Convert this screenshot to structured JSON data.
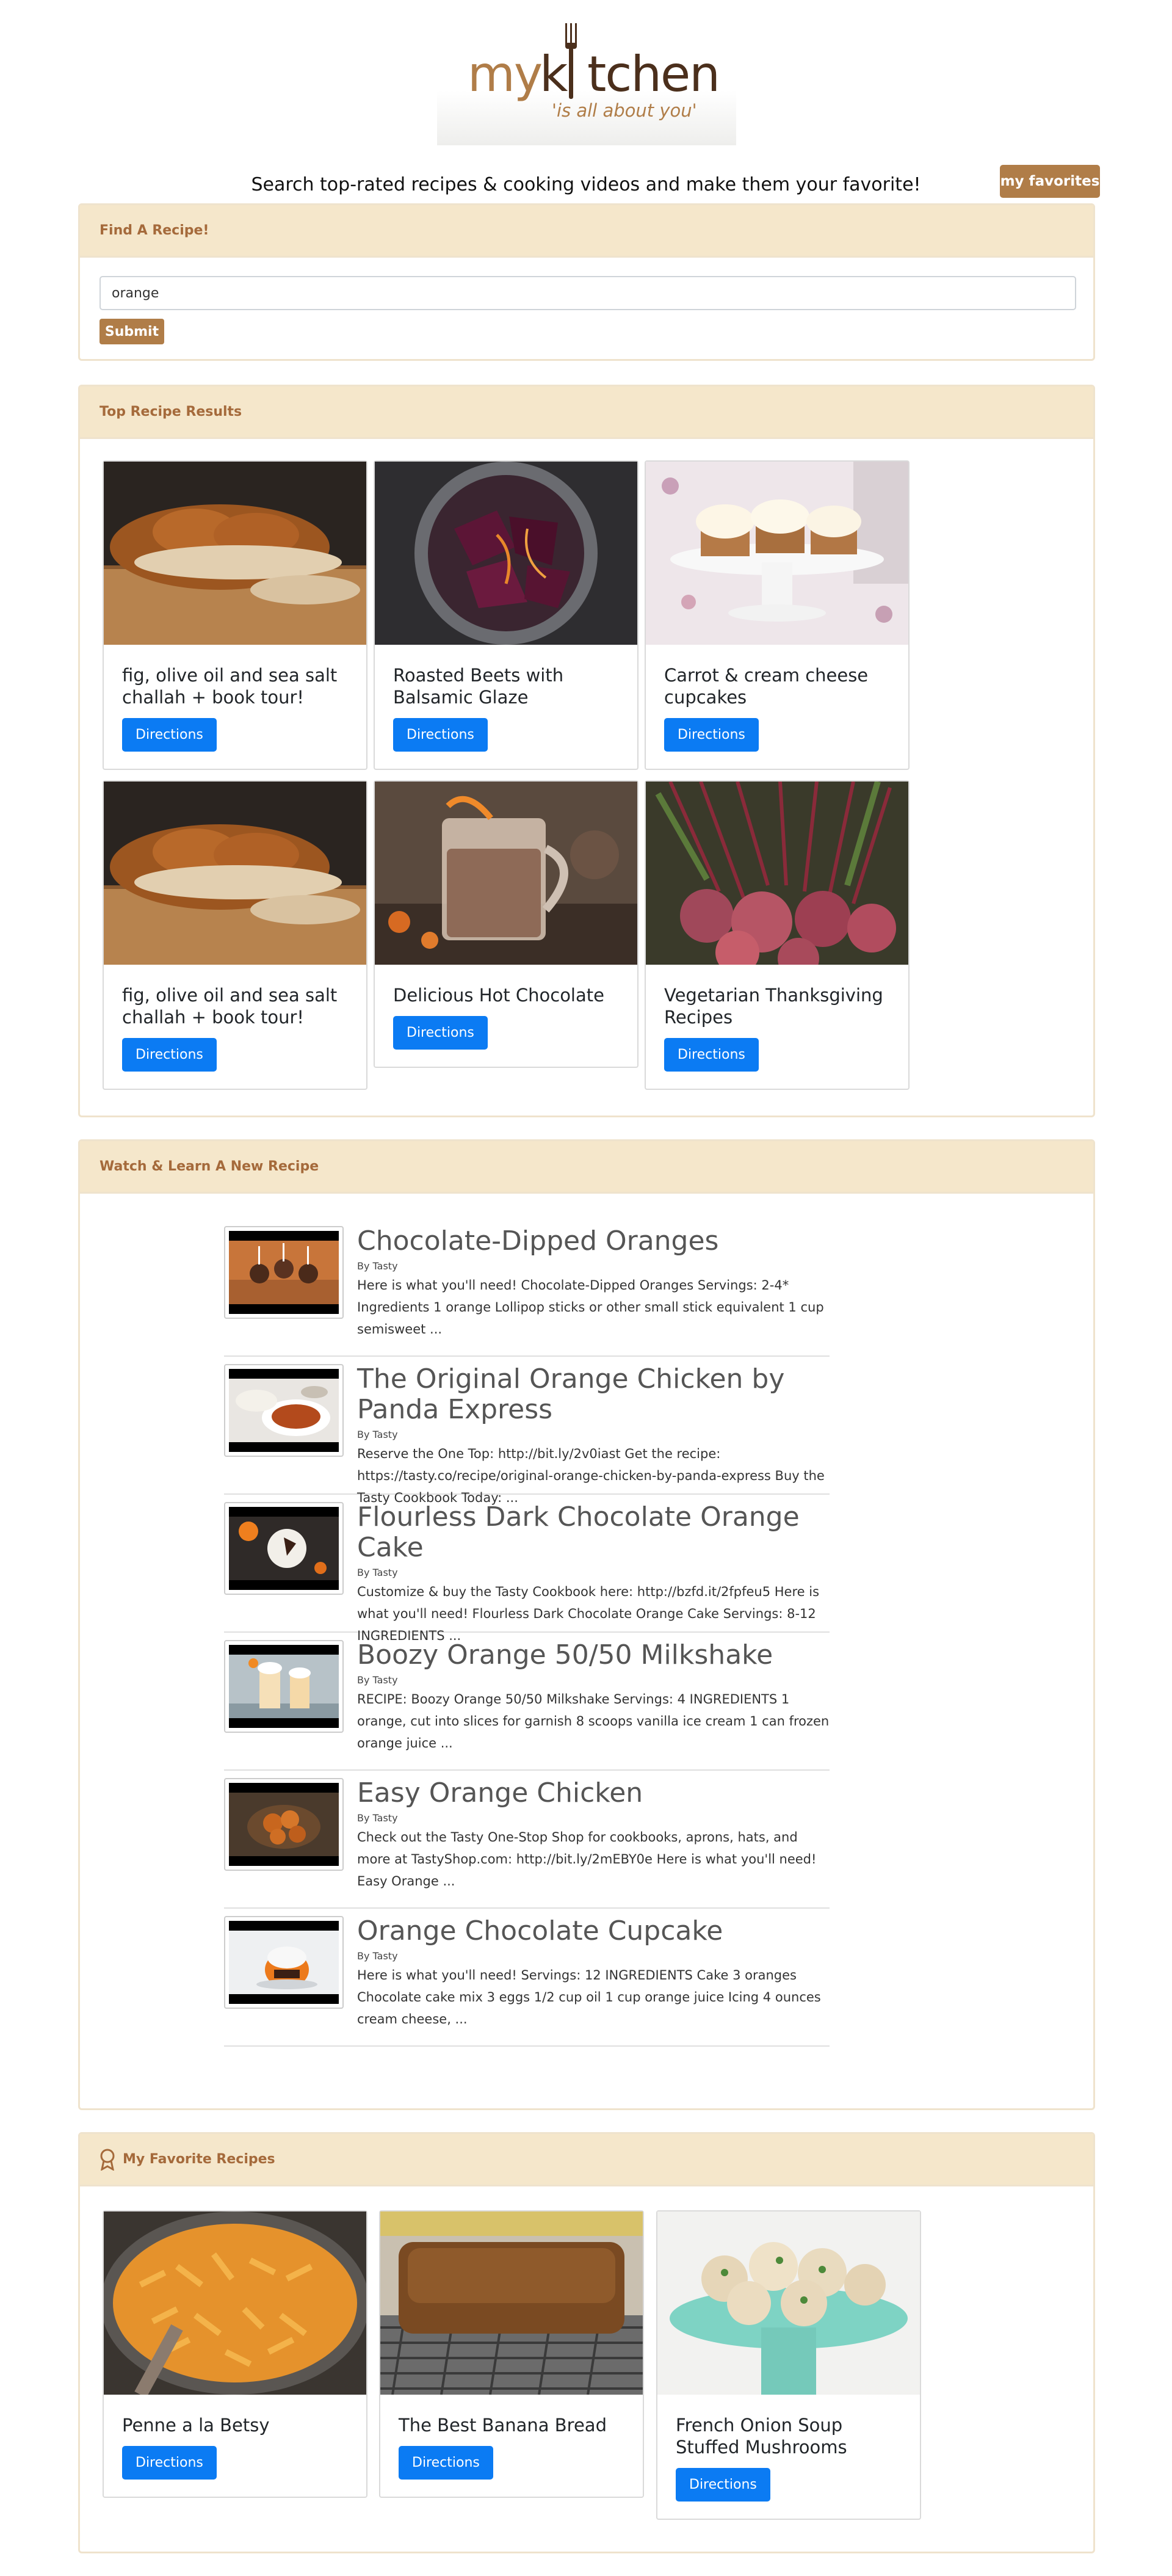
{
  "header": {
    "logo_my": "my",
    "logo_k": "k",
    "logo_tchen": "tchen",
    "logo_tagline": "'is all about you'",
    "tagline": "Search top-rated recipes & cooking videos and make them your favorite!",
    "favorites_button": "my favorites"
  },
  "find": {
    "title": "Find A Recipe!",
    "query": "orange",
    "submit": "Submit"
  },
  "results": {
    "title": "Top Recipe Results",
    "cards": [
      {
        "title": "fig, olive oil and sea salt challah + book tour!",
        "button": "Directions",
        "image": "braided-bread"
      },
      {
        "title": "Roasted Beets with Balsamic Glaze",
        "button": "Directions",
        "image": "roasted-beets"
      },
      {
        "title": "Carrot & cream cheese cupcakes",
        "button": "Directions",
        "image": "cupcakes"
      },
      {
        "title": "fig, olive oil and sea salt challah + book tour!",
        "button": "Directions",
        "image": "braided-bread"
      },
      {
        "title": "Delicious Hot Chocolate",
        "button": "Directions",
        "image": "hot-chocolate"
      },
      {
        "title": "Vegetarian Thanksgiving Recipes",
        "button": "Directions",
        "image": "beets-bunch"
      }
    ]
  },
  "videos": {
    "title": "Watch & Learn A New Recipe",
    "items": [
      {
        "title": "Chocolate-Dipped Oranges",
        "by": "By Tasty",
        "desc": "Here is what you'll need! Chocolate-Dipped Oranges Servings: 2-4* Ingredients 1 orange Lollipop sticks or other small stick equivalent 1 cup semisweet ..."
      },
      {
        "title": "The Original Orange Chicken by Panda Express",
        "by": "By Tasty",
        "desc": "Reserve the One Top: http://bit.ly/2v0iast Get the recipe: https://tasty.co/recipe/original-orange-chicken-by-panda-express Buy the Tasty Cookbook Today: ..."
      },
      {
        "title": "Flourless Dark Chocolate Orange Cake",
        "by": "By Tasty",
        "desc": "Customize & buy the Tasty Cookbook here: http://bzfd.it/2fpfeu5 Here is what you'll need! Flourless Dark Chocolate Orange Cake Servings: 8-12 INGREDIENTS ..."
      },
      {
        "title": "Boozy Orange 50/50 Milkshake",
        "by": "By Tasty",
        "desc": "RECIPE: Boozy Orange 50/50 Milkshake Servings: 4 INGREDIENTS 1 orange, cut into slices for garnish 8 scoops vanilla ice cream 1 can frozen orange juice ..."
      },
      {
        "title": "Easy Orange Chicken",
        "by": "By Tasty",
        "desc": "Check out the Tasty One-Stop Shop for cookbooks, aprons, hats, and more at TastyShop.com: http://bit.ly/2mEBY0e Here is what you'll need! Easy Orange ..."
      },
      {
        "title": "Orange Chocolate Cupcake",
        "by": "By Tasty",
        "desc": "Here is what you'll need! Servings: 12 INGREDIENTS Cake 3 oranges Chocolate cake mix 3 eggs 1/2 cup oil 1 cup orange juice Icing 4 ounces cream cheese, ..."
      }
    ]
  },
  "favorites": {
    "title": "My Favorite Recipes",
    "cards": [
      {
        "title": "Penne a la Betsy",
        "button": "Directions",
        "image": "penne"
      },
      {
        "title": "The Best Banana Bread",
        "button": "Directions",
        "image": "banana-bread"
      },
      {
        "title": "French Onion Soup Stuffed Mushrooms",
        "button": "Directions",
        "image": "stuffed-mushrooms"
      }
    ]
  }
}
